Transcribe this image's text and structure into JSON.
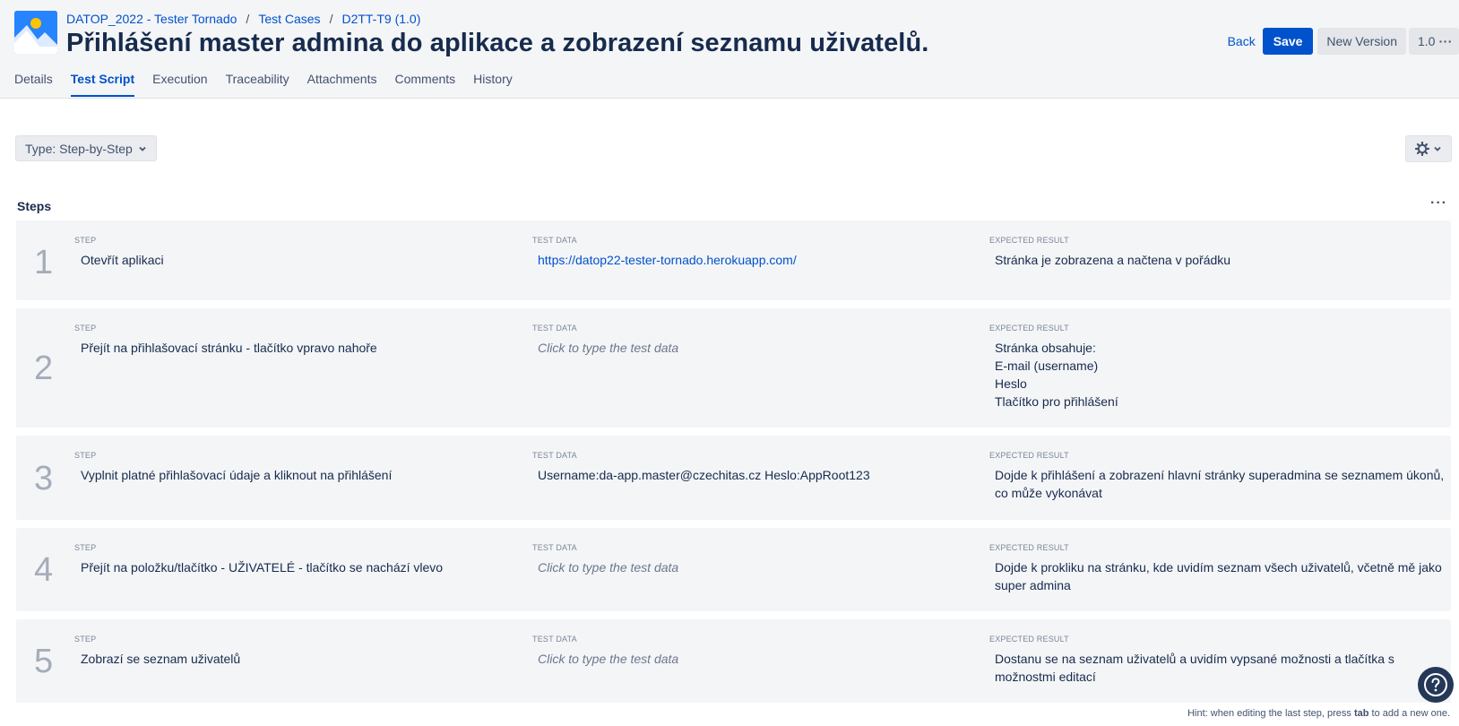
{
  "breadcrumb": {
    "project": "DATOP_2022 - Tester Tornado",
    "sep": "/",
    "section": "Test Cases",
    "key": "D2TT-T9 (1.0)"
  },
  "page_title": "Přihlášení master admina do aplikace a zobrazení seznamu uživatelů.",
  "actions": {
    "back": "Back",
    "save": "Save",
    "new_version": "New Version",
    "version": "1.0"
  },
  "tabs": [
    "Details",
    "Test Script",
    "Execution",
    "Traceability",
    "Attachments",
    "Comments",
    "History"
  ],
  "active_tab": "Test Script",
  "type_select": "Type: Step-by-Step",
  "steps_title": "Steps",
  "col_labels": {
    "step": "STEP",
    "test_data": "TEST DATA",
    "expected": "EXPECTED RESULT"
  },
  "steps": [
    {
      "num": "1",
      "step": "Otevřít aplikaci",
      "test_data": "https://datop22-tester-tornado.herokuapp.com/",
      "expected": [
        "Stránka je zobrazena a načtena v pořádku"
      ]
    },
    {
      "num": "2",
      "step": "Přejít na přihlašovací stránku - tlačítko vpravo nahoře",
      "test_data": "Click to type the test data",
      "expected": [
        "Stránka obsahuje:",
        "E-mail (username)",
        "Heslo",
        "Tlačítko pro přihlášení"
      ]
    },
    {
      "num": "3",
      "step": "Vyplnit platné přihlašovací údaje a kliknout na přihlášení",
      "test_data": "Username:da-app.master@czechitas.cz Heslo:AppRoot123",
      "expected": [
        "Dojde k přihlášení a zobrazení hlavní stránky superadmina se seznamem úkonů,",
        "co může vykonávat"
      ]
    },
    {
      "num": "4",
      "step": "Přejít na položku/tlačítko - UŽIVATELÉ - tlačítko se nachází vlevo",
      "test_data": "Click to type the test data",
      "expected": [
        "Dojde k prokliku na stránku, kde uvidím seznam všech uživatelů, včetně mě jako",
        "super admina"
      ]
    },
    {
      "num": "5",
      "step": "Zobrazí se seznam uživatelů",
      "test_data": "Click to type the test data",
      "expected": [
        "Dostanu se na seznam uživatelů a uvidím vypsané možnosti a tlačítka s",
        "možnostmi editací"
      ]
    }
  ],
  "hint": {
    "before": "Hint: when editing the last step, press ",
    "key": "tab",
    "after": " to add a new one."
  },
  "colors": {
    "accent": "#0052cc",
    "header_bg": "#f4f5f7",
    "step_bg": "#f4f5f7",
    "step_number": "#a5adba"
  }
}
